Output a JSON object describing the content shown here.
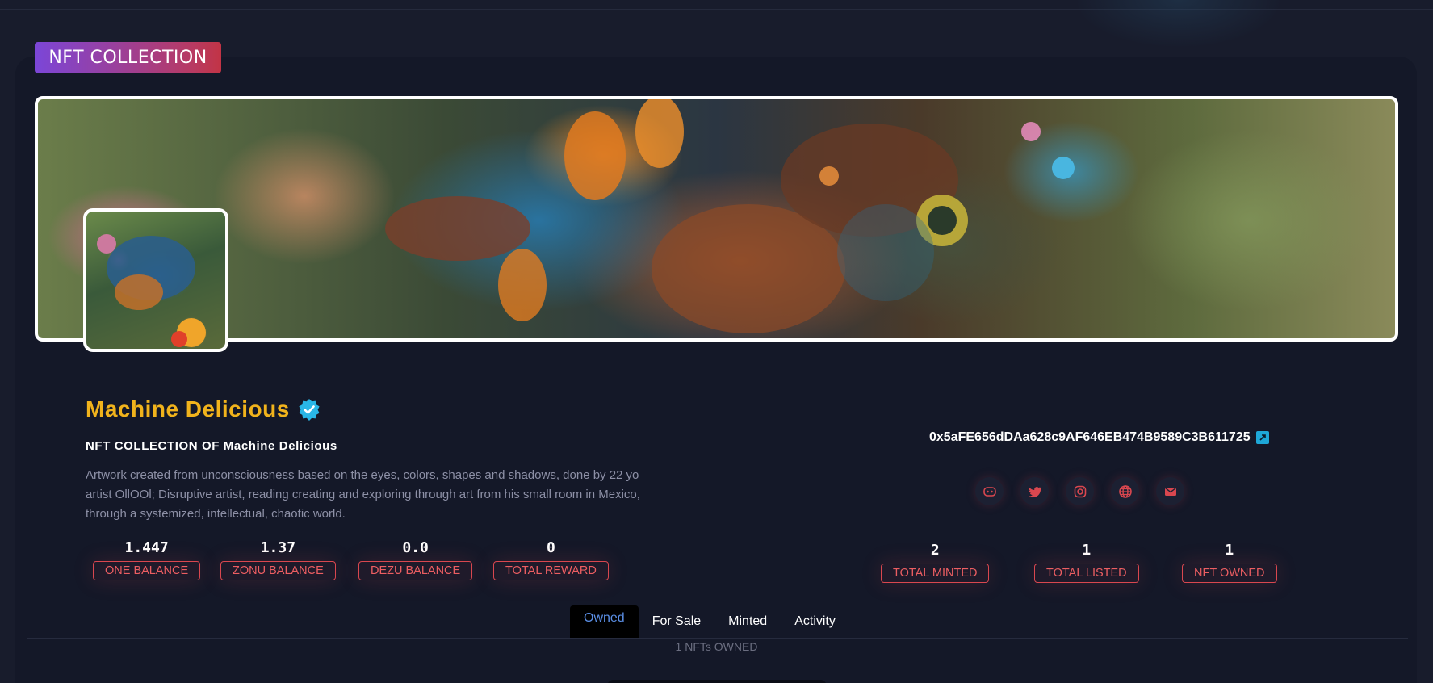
{
  "header": {
    "section_title": "NFT COLLECTION"
  },
  "profile": {
    "name": "Machine Delicious",
    "verified": true,
    "subtitle": "NFT COLLECTION OF Machine Delicious",
    "description": "Artwork created from unconsciousness based on the eyes, colors, shapes and shadows, done by 22 yo artist OllOOl; Disruptive artist, reading creating and exploring through art from his small room in Mexico, through a systemized, intellectual, chaotic world.",
    "wallet_address": "0x5aFE656dDAa628c9AF646EB474B9589C3B611725"
  },
  "balances": [
    {
      "value": "1.447",
      "label": "ONE BALANCE"
    },
    {
      "value": "1.37",
      "label": "ZONU BALANCE"
    },
    {
      "value": "0.0",
      "label": "DEZU BALANCE"
    },
    {
      "value": "0",
      "label": "TOTAL REWARD"
    }
  ],
  "totals": [
    {
      "value": "2",
      "label": "TOTAL MINTED"
    },
    {
      "value": "1",
      "label": "TOTAL LISTED"
    },
    {
      "value": "1",
      "label": "NFT OWNED"
    }
  ],
  "socials": [
    {
      "icon": "discord-icon"
    },
    {
      "icon": "twitter-icon"
    },
    {
      "icon": "instagram-icon"
    },
    {
      "icon": "globe-icon"
    },
    {
      "icon": "email-icon"
    }
  ],
  "tabs": [
    {
      "label": "Owned",
      "active": true
    },
    {
      "label": "For Sale",
      "active": false
    },
    {
      "label": "Minted",
      "active": false
    },
    {
      "label": "Activity",
      "active": false
    }
  ],
  "owned_count_text": "1 NFTs OWNED",
  "colors": {
    "accent_gold": "#f1b31c",
    "stat_red": "#d9474f",
    "verified_blue": "#29b6e6",
    "tab_active": "#5b8fe6"
  }
}
